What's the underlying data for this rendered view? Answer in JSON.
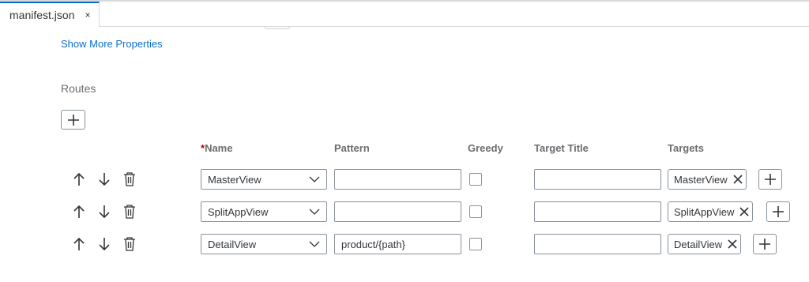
{
  "tab": {
    "title": "manifest.json",
    "close_glyph": "×"
  },
  "show_more_label": "Show More Properties",
  "routes_label": "Routes",
  "columns": {
    "required_mark": "*",
    "name": "Name",
    "pattern": "Pattern",
    "greedy": "Greedy",
    "target_title": "Target Title",
    "targets": "Targets"
  },
  "routes": [
    {
      "name": "MasterView",
      "pattern": "",
      "greedy": false,
      "target_title": "",
      "target": "MasterView"
    },
    {
      "name": "SplitAppView",
      "pattern": "",
      "greedy": false,
      "target_title": "",
      "target": "SplitAppView"
    },
    {
      "name": "DetailView",
      "pattern": "product/{path}",
      "greedy": false,
      "target_title": "",
      "target": "DetailView"
    }
  ],
  "colors": {
    "accent": "#0a6ed1",
    "required": "#bb0000",
    "border": "#89919a",
    "label": "#6a6d70"
  },
  "icons": [
    "close-icon",
    "add-icon",
    "arrow-up-icon",
    "arrow-down-icon",
    "delete-icon",
    "chevron-down-icon",
    "token-remove-icon"
  ]
}
